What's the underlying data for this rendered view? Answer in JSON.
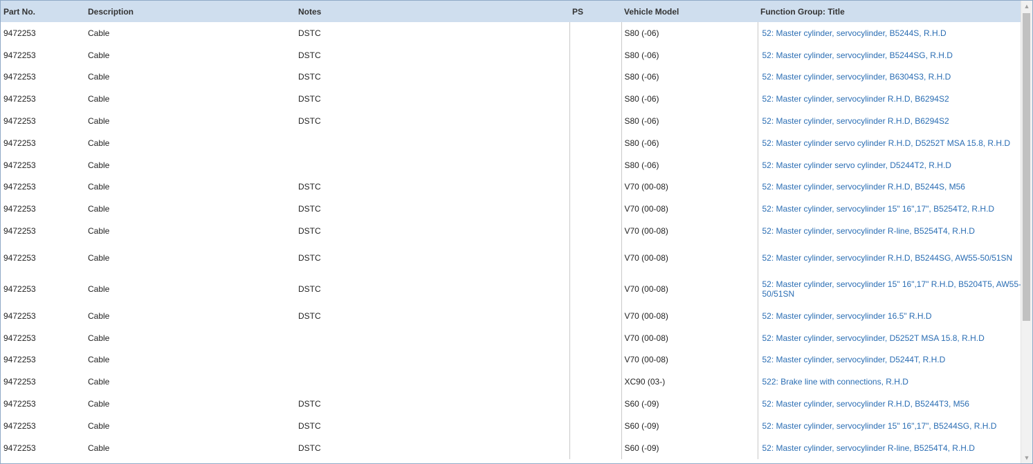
{
  "columns": {
    "part_no": "Part No.",
    "description": "Description",
    "notes": "Notes",
    "ps": "PS",
    "vehicle_model": "Vehicle Model",
    "function_group": "Function Group: Title"
  },
  "rows": [
    {
      "part_no": "9472253",
      "description": "Cable",
      "notes": "DSTC",
      "ps": "",
      "vehicle_model": "S80 (-06)",
      "function_group": "52: Master cylinder, servocylinder, B5244S, R.H.D"
    },
    {
      "part_no": "9472253",
      "description": "Cable",
      "notes": "DSTC",
      "ps": "",
      "vehicle_model": "S80 (-06)",
      "function_group": "52: Master cylinder, servocylinder, B5244SG, R.H.D"
    },
    {
      "part_no": "9472253",
      "description": "Cable",
      "notes": "DSTC",
      "ps": "",
      "vehicle_model": "S80 (-06)",
      "function_group": "52: Master cylinder, servocylinder, B6304S3, R.H.D"
    },
    {
      "part_no": "9472253",
      "description": "Cable",
      "notes": "DSTC",
      "ps": "",
      "vehicle_model": "S80 (-06)",
      "function_group": "52: Master cylinder, servocylinder   R.H.D, B6294S2"
    },
    {
      "part_no": "9472253",
      "description": "Cable",
      "notes": "DSTC",
      "ps": "",
      "vehicle_model": "S80 (-06)",
      "function_group": "52: Master cylinder, servocylinder   R.H.D, B6294S2"
    },
    {
      "part_no": "9472253",
      "description": "Cable",
      "notes": "",
      "ps": "",
      "vehicle_model": "S80 (-06)",
      "function_group": "52: Master cylinder servo cylinder  R.H.D, D5252T MSA 15.8, R.H.D"
    },
    {
      "part_no": "9472253",
      "description": "Cable",
      "notes": "",
      "ps": "",
      "vehicle_model": "S80 (-06)",
      "function_group": "52: Master cylinder servo cylinder, D5244T2, R.H.D"
    },
    {
      "part_no": "9472253",
      "description": "Cable",
      "notes": "DSTC",
      "ps": "",
      "vehicle_model": "V70 (00-08)",
      "function_group": "52: Master cylinder, servocylinder   R.H.D, B5244S, M56"
    },
    {
      "part_no": "9472253",
      "description": "Cable",
      "notes": "DSTC",
      "ps": "",
      "vehicle_model": "V70 (00-08)",
      "function_group": "52: Master cylinder, servocylinder 15\" 16\",17\", B5254T2, R.H.D"
    },
    {
      "part_no": "9472253",
      "description": "Cable",
      "notes": "DSTC",
      "ps": "",
      "vehicle_model": "V70 (00-08)",
      "function_group": "52: Master cylinder, servocylinder R-line, B5254T4, R.H.D"
    },
    {
      "part_no": "9472253",
      "description": "Cable",
      "notes": "DSTC",
      "ps": "",
      "vehicle_model": "V70 (00-08)",
      "function_group": "52: Master cylinder, servocylinder   R.H.D, B5244SG, AW55-50/51SN"
    },
    {
      "part_no": "9472253",
      "description": "Cable",
      "notes": "DSTC",
      "ps": "",
      "vehicle_model": "V70 (00-08)",
      "function_group": "52: Master cylinder, servocylinder 15\" 16\",17\" R.H.D, B5204T5, AW55-50/51SN"
    },
    {
      "part_no": "9472253",
      "description": "Cable",
      "notes": "DSTC",
      "ps": "",
      "vehicle_model": "V70 (00-08)",
      "function_group": "52: Master cylinder, servocylinder 16.5\"  R.H.D"
    },
    {
      "part_no": "9472253",
      "description": "Cable",
      "notes": "",
      "ps": "",
      "vehicle_model": "V70 (00-08)",
      "function_group": "52: Master cylinder, servocylinder, D5252T MSA 15.8, R.H.D"
    },
    {
      "part_no": "9472253",
      "description": "Cable",
      "notes": "",
      "ps": "",
      "vehicle_model": "V70 (00-08)",
      "function_group": "52: Master cylinder, servocylinder, D5244T, R.H.D"
    },
    {
      "part_no": "9472253",
      "description": "Cable",
      "notes": "",
      "ps": "",
      "vehicle_model": "XC90 (03-)",
      "function_group": "522: Brake line with connections, R.H.D"
    },
    {
      "part_no": "9472253",
      "description": "Cable",
      "notes": "DSTC",
      "ps": "",
      "vehicle_model": "S60 (-09)",
      "function_group": "52: Master cylinder, servocylinder   R.H.D, B5244T3, M56"
    },
    {
      "part_no": "9472253",
      "description": "Cable",
      "notes": "DSTC",
      "ps": "",
      "vehicle_model": "S60 (-09)",
      "function_group": "52: Master cylinder, servocylinder 15\" 16\",17\", B5244SG, R.H.D"
    },
    {
      "part_no": "9472253",
      "description": "Cable",
      "notes": "DSTC",
      "ps": "",
      "vehicle_model": "S60 (-09)",
      "function_group": "52: Master cylinder, servocylinder R-line, B5254T4, R.H.D"
    }
  ],
  "colors": {
    "header_bg": "#cfdeee",
    "link": "#2a6db3",
    "scroll_thumb": "#c1c1c1"
  },
  "icons": {
    "scroll_up": "chevron-up-icon",
    "scroll_down": "chevron-down-icon"
  }
}
